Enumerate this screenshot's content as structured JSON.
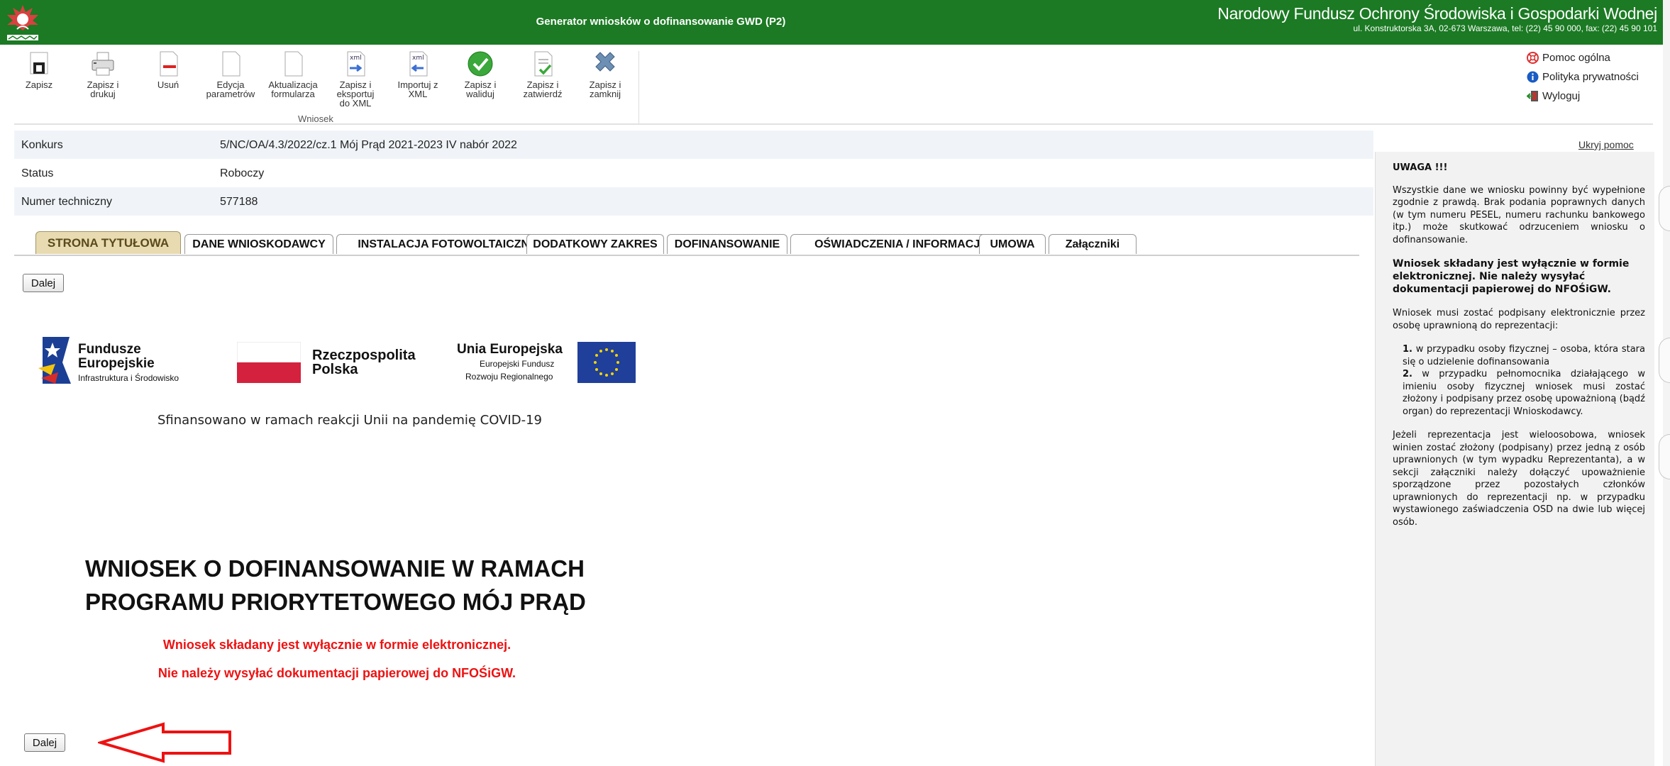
{
  "header": {
    "app_title": "Generator wniosków o dofinansowanie GWD (P2)",
    "org_name": "Narodowy Fundusz Ochrony Środowiska i Gospodarki Wodnej",
    "org_address": "ul. Konstruktorska 3A, 02-673 Warszawa, tel: (22) 45 90 000, fax: (22) 45 90 101",
    "bg_color": "#1b7a23"
  },
  "toolbar": {
    "group_label": "Wniosek",
    "buttons": [
      {
        "label_lines": [
          "Zapisz"
        ],
        "icon": "save-icon"
      },
      {
        "label_lines": [
          "Zapisz i",
          "drukuj"
        ],
        "icon": "print-icon"
      },
      {
        "label_lines": [
          "Usuń"
        ],
        "icon": "delete-icon"
      },
      {
        "label_lines": [
          "Edycja",
          "parametrów"
        ],
        "icon": "document-icon"
      },
      {
        "label_lines": [
          "Aktualizacja",
          "formularza"
        ],
        "icon": "document-icon"
      },
      {
        "label_lines": [
          "Zapisz i",
          "eksportuj",
          "do XML"
        ],
        "icon": "xml-export-icon"
      },
      {
        "label_lines": [
          "Importuj z",
          "XML"
        ],
        "icon": "xml-import-icon"
      },
      {
        "label_lines": [
          "Zapisz i",
          "waliduj"
        ],
        "icon": "check-icon"
      },
      {
        "label_lines": [
          "Zapisz i",
          "zatwierdź"
        ],
        "icon": "approve-icon"
      },
      {
        "label_lines": [
          "Zapisz i",
          "zamknij"
        ],
        "icon": "close-icon"
      }
    ]
  },
  "help_links": [
    {
      "label": "Pomoc ogólna",
      "icon": "lifebuoy-icon"
    },
    {
      "label": "Polityka prywatności",
      "icon": "info-icon"
    },
    {
      "label": "Wyloguj",
      "icon": "logout-icon"
    }
  ],
  "info_rows": [
    {
      "label": "Konkurs",
      "value": "5/NC/OA/4.3/2022/cz.1 Mój Prąd 2021-2023 IV nabór 2022"
    },
    {
      "label": "Status",
      "value": "Roboczy"
    },
    {
      "label": "Numer techniczny",
      "value": "577188"
    }
  ],
  "tabs": [
    {
      "label": "STRONA TYTUŁOWA",
      "active": true
    },
    {
      "label": "DANE WNIOSKODAWCY"
    },
    {
      "label": "INSTALACJA FOTOWOLTAICZNA"
    },
    {
      "label": "DODATKOWY ZAKRES"
    },
    {
      "label": "DOFINANSOWANIE"
    },
    {
      "label": "OŚWIADCZENIA / INFORMACJE"
    },
    {
      "label": "UMOWA"
    },
    {
      "label": "Załączniki"
    }
  ],
  "buttons": {
    "next_label": "Dalej"
  },
  "logos": {
    "fe_line1": "Fundusze",
    "fe_line2": "Europejskie",
    "fe_line3": "Infrastruktura i Środowisko",
    "rp_line1": "Rzeczpospolita",
    "rp_line2": "Polska",
    "ue_line1": "Unia Europejska",
    "ue_line2": "Europejski Fundusz",
    "ue_line3": "Rozwoju Regionalnego"
  },
  "covid_note": "Sfinansowano w ramach reakcji Unii na pandemię COVID-19",
  "main_title": {
    "line1": "WNIOSEK O DOFINANSOWANIE W RAMACH",
    "line2": "PROGRAMU PRIORYTETOWEGO MÓJ PRĄD"
  },
  "red_notes": {
    "line1": "Wniosek składany jest wyłącznie w formie elektronicznej.",
    "line2": "Nie należy wysyłać dokumentacji papierowej do NFOŚiGW."
  },
  "side_panel": {
    "hide_link": "Ukryj pomoc",
    "heading": "UWAGA !!!",
    "p1": "Wszystkie dane we wniosku powinny być wypełnione zgodnie z prawdą. Brak podania poprawnych danych (w tym numeru PESEL, numeru rachunku bankowego itp.) może skutkować odrzuceniem wniosku o dofinansowanie.",
    "p2": "Wniosek składany jest wyłącznie w formie elektronicznej. Nie należy wysyłać dokumentacji papierowej do NFOŚiGW.",
    "p3": "Wniosek musi zostać podpisany elektronicznie przez osobę uprawnioną do reprezentacji:",
    "li1_num": "1.",
    "li1": "w przypadku osoby fizycznej – osoba, która stara się o udzielenie dofinansowania",
    "li2_num": "2.",
    "li2": "w przypadku pełnomocnika działającego w imieniu osoby fizycznej wniosek musi zostać złożony i podpisany przez osobę upoważnioną (bądź organ) do reprezentacji Wnioskodawcy.",
    "p4": "Jeżeli reprezentacja jest wieloosobowa, wniosek winien zostać złożony (podpisany) przez jedną z osób uprawnionych (w tym wypadku Reprezentanta), a w sekcji załączniki należy dołączyć upoważnienie sporządzone przez pozostałych członków uprawnionych do reprezentacji np. w przypadku wystawionego zaświadczenia OSD na dwie lub więcej osób."
  },
  "colors": {
    "accent_red": "#e11111",
    "active_tab": "#e8dbb1",
    "panel_bg": "#f2f2f2"
  }
}
